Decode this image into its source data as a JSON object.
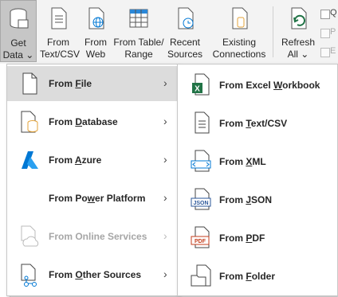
{
  "ribbon": {
    "get_data": {
      "line1": "Get",
      "line2": "Data ⌄"
    },
    "from_text_csv": {
      "line1": "From",
      "line2": "Text/CSV"
    },
    "from_web": {
      "line1": "From",
      "line2": "Web"
    },
    "from_table_range": {
      "line1": "From Table/",
      "line2": "Range"
    },
    "recent_sources": {
      "line1": "Recent",
      "line2": "Sources"
    },
    "existing_connections": {
      "line1": "Existing",
      "line2": "Connections"
    },
    "refresh_all": {
      "line1": "Refresh",
      "line2": "All ⌄"
    },
    "side_labels": [
      "Q",
      "P",
      "E"
    ]
  },
  "menu": {
    "items": [
      {
        "pre": "From ",
        "key": "F",
        "post": "ile",
        "icon": "file-icon",
        "arrow": "›"
      },
      {
        "pre": "From ",
        "key": "D",
        "post": "atabase",
        "icon": "database-icon",
        "arrow": "›"
      },
      {
        "pre": "From ",
        "key": "A",
        "post": "zure",
        "icon": "azure-icon",
        "arrow": "›"
      },
      {
        "pre": "From Po",
        "key": "w",
        "post": "er Platform",
        "icon": "",
        "arrow": "›"
      },
      {
        "pre": "From Online Services",
        "key": "",
        "post": "",
        "icon": "cloud-icon",
        "arrow": "›"
      },
      {
        "pre": "From ",
        "key": "O",
        "post": "ther Sources",
        "icon": "other-sources-icon",
        "arrow": "›"
      }
    ]
  },
  "submenu": {
    "items": [
      {
        "pre": "From Excel ",
        "key": "W",
        "post": "orkbook",
        "icon": "excel-workbook-icon"
      },
      {
        "pre": "From ",
        "key": "T",
        "post": "ext/CSV",
        "icon": "text-csv-icon"
      },
      {
        "pre": "From ",
        "key": "X",
        "post": "ML",
        "icon": "xml-icon"
      },
      {
        "pre": "From ",
        "key": "J",
        "post": "SON",
        "icon": "json-icon"
      },
      {
        "pre": "From ",
        "key": "P",
        "post": "DF",
        "icon": "pdf-icon"
      },
      {
        "pre": "From ",
        "key": "F",
        "post": "older",
        "icon": "folder-icon"
      }
    ]
  },
  "colors": {
    "excel_green": "#217346",
    "azure_blue": "#0078d4",
    "db_orange": "#e3a33a",
    "json_blue": "#2b579a",
    "pdf_red": "#c43e1c"
  }
}
